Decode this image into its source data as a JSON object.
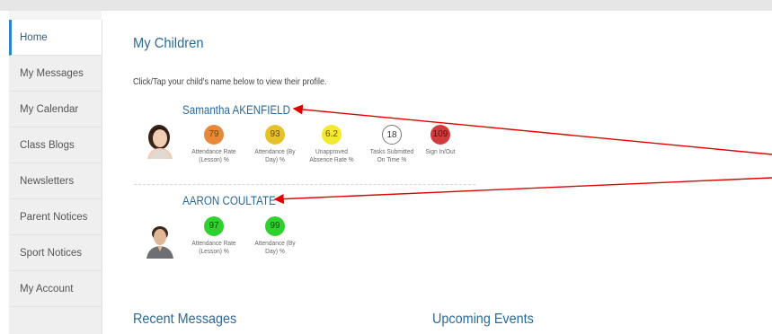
{
  "sidebar": {
    "items": [
      {
        "label": "Home",
        "active": true
      },
      {
        "label": "My Messages"
      },
      {
        "label": "My Calendar"
      },
      {
        "label": "Class Blogs"
      },
      {
        "label": "Newsletters"
      },
      {
        "label": "Parent Notices"
      },
      {
        "label": "Sport Notices"
      },
      {
        "label": "My Account"
      }
    ]
  },
  "main": {
    "title": "My Children",
    "instruction": "Click/Tap your child's name below to view their profile.",
    "children": [
      {
        "name": "Samantha AKENFIELD",
        "metrics": [
          {
            "value": "79",
            "label": "Attendance Rate (Lesson) %",
            "color": "#e8893a"
          },
          {
            "value": "93",
            "label": "Attendance (By Day) %",
            "color": "#e6c22a"
          },
          {
            "value": "6.2",
            "label": "Unapproved Absence Rate %",
            "color": "#f2ea2e"
          },
          {
            "value": "18",
            "label": "Tasks Submitted On Time %",
            "color": "#ffffff"
          },
          {
            "value": "109",
            "label": "Sign In/Out",
            "color": "#d23b3b"
          }
        ]
      },
      {
        "name": "AARON COULTATE",
        "metrics": [
          {
            "value": "97",
            "label": "Attendance Rate (Lesson) %",
            "color": "#2fd12f"
          },
          {
            "value": "99",
            "label": "Attendance (By Day) %",
            "color": "#2fd12f"
          }
        ]
      }
    ],
    "recent_messages_title": "Recent Messages",
    "upcoming_events_title": "Upcoming Events"
  },
  "annotation": {
    "arrow_color": "#e00000"
  }
}
